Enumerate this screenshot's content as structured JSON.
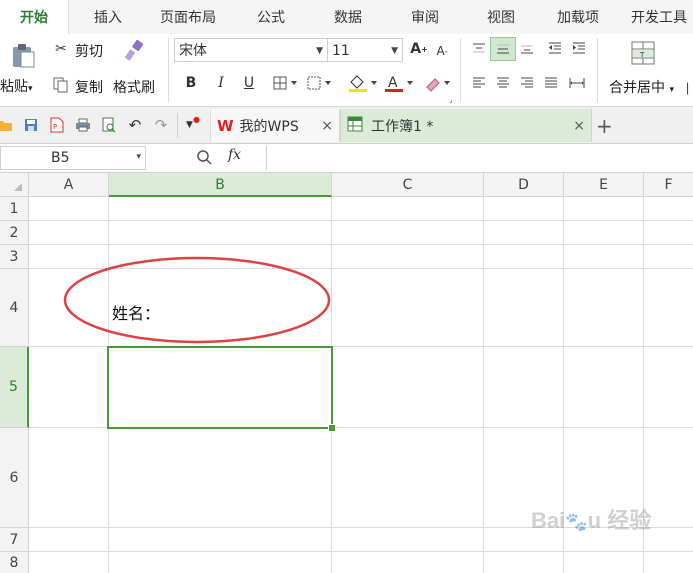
{
  "ribbon_tabs": [
    "开始",
    "插入",
    "页面布局",
    "公式",
    "数据",
    "审阅",
    "视图",
    "加载项",
    "开发工具"
  ],
  "clipboard": {
    "cut": "剪切",
    "paste": "粘贴",
    "copy": "复制",
    "format_painter": "格式刷"
  },
  "font": {
    "name": "宋体",
    "size": "11"
  },
  "merge_label": "合并居中",
  "doc_tabs": [
    {
      "label": "我的WPS",
      "close": "×"
    },
    {
      "label": "工作簿1 *",
      "close": "×"
    }
  ],
  "new_tab": "+",
  "formula_bar": {
    "cell_ref": "B5",
    "fx": "fx",
    "value": ""
  },
  "grid": {
    "columns": [
      "A",
      "B",
      "C",
      "D",
      "E",
      "F"
    ],
    "rows": [
      "1",
      "2",
      "3",
      "4",
      "5",
      "6",
      "7",
      "8"
    ],
    "selected_cell": "B5",
    "cells": {
      "B4": "姓名："
    }
  },
  "colors": {
    "accent": "#2e7d32",
    "selection": "#4a9a3a",
    "ellipse": "#e04040"
  }
}
